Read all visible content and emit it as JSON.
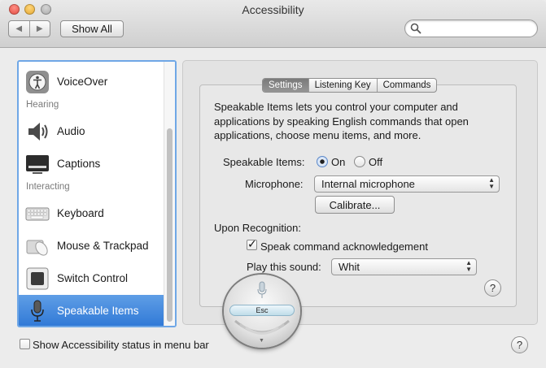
{
  "window": {
    "title": "Accessibility"
  },
  "toolbar": {
    "back_icon": "back-arrow-icon",
    "forward_icon": "forward-arrow-icon",
    "show_all_label": "Show All",
    "search_value": ""
  },
  "sidebar": {
    "items": [
      {
        "label": "VoiceOver",
        "icon": "voiceover-icon"
      },
      {
        "header": "Hearing"
      },
      {
        "label": "Audio",
        "icon": "speaker-icon"
      },
      {
        "label": "Captions",
        "icon": "captions-icon"
      },
      {
        "header": "Interacting"
      },
      {
        "label": "Keyboard",
        "icon": "keyboard-icon"
      },
      {
        "label": "Mouse & Trackpad",
        "icon": "mouse-trackpad-icon"
      },
      {
        "label": "Switch Control",
        "icon": "switch-control-icon"
      },
      {
        "label": "Speakable Items",
        "icon": "microphone-icon",
        "selected": true
      }
    ]
  },
  "pane": {
    "tabs": [
      {
        "label": "Settings",
        "active": true
      },
      {
        "label": "Listening Key",
        "active": false
      },
      {
        "label": "Commands",
        "active": false
      }
    ],
    "description": "Speakable Items lets you control your computer and applications by speaking English commands that open applications, choose menu items, and more.",
    "speakable_items_label": "Speakable Items:",
    "on_label": "On",
    "off_label": "Off",
    "speakable_items_state": "On",
    "microphone_label": "Microphone:",
    "microphone_value": "Internal microphone",
    "calibrate_label": "Calibrate...",
    "upon_recognition_label": "Upon Recognition:",
    "speak_ack_label": "Speak command acknowledgement",
    "speak_ack_checked": true,
    "play_sound_label": "Play this sound:",
    "play_sound_value": "Whit",
    "help_label": "?"
  },
  "footer": {
    "status_menu_label": "Show Accessibility status in menu bar",
    "status_menu_checked": false,
    "help_label": "?"
  },
  "hud": {
    "esc_label": "Esc"
  },
  "colors": {
    "accent": "#2f78d6",
    "selection_top": "#5f9ee6",
    "sidebar_border": "#6fa7e6"
  }
}
